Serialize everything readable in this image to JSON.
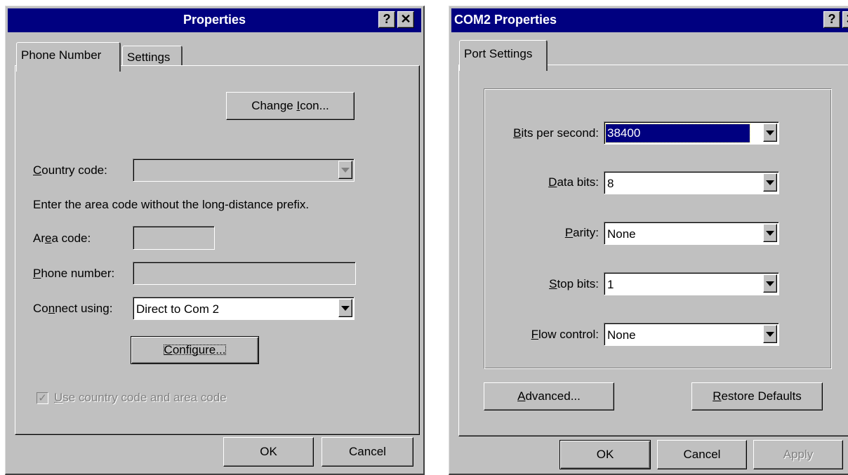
{
  "properties_dialog": {
    "title": "Properties",
    "help_glyph": "?",
    "close_glyph": "✕",
    "tabs": [
      "Phone Number",
      "Settings"
    ],
    "change_icon_button": {
      "pre": "Change ",
      "key": "I",
      "post": "con..."
    },
    "country_code": {
      "pre": "",
      "key": "C",
      "post": "ountry code:",
      "value": ""
    },
    "instruction_text": "Enter the area code without the long-distance prefix.",
    "area_code": {
      "pre": "Ar",
      "key": "e",
      "post": "a code:",
      "value": ""
    },
    "phone_number": {
      "pre": "",
      "key": "P",
      "post": "hone number:",
      "value": ""
    },
    "connect_using": {
      "pre": "Co",
      "key": "n",
      "post": "nect using:",
      "value": "Direct to Com 2"
    },
    "configure_button": {
      "pre": "",
      "key": "C",
      "post": "onfigure..."
    },
    "use_country_code": {
      "pre": "",
      "key": "U",
      "post": "se country code and area code",
      "checked": true
    },
    "ok_button": "OK",
    "cancel_button": "Cancel"
  },
  "com2_dialog": {
    "title": "COM2 Properties",
    "help_glyph": "?",
    "close_glyph": "✕",
    "tab": "Port Settings",
    "fields": {
      "bits_per_second": {
        "pre": "",
        "key": "B",
        "post": "its per second:",
        "value": "38400"
      },
      "data_bits": {
        "pre": "",
        "key": "D",
        "post": "ata bits:",
        "value": "8"
      },
      "parity": {
        "pre": "",
        "key": "P",
        "post": "arity:",
        "value": "None"
      },
      "stop_bits": {
        "pre": "",
        "key": "S",
        "post": "top bits:",
        "value": "1"
      },
      "flow_control": {
        "pre": "",
        "key": "F",
        "post": "low control:",
        "value": "None"
      }
    },
    "advanced_button": {
      "pre": "",
      "key": "A",
      "post": "dvanced..."
    },
    "restore_defaults_button": {
      "pre": "",
      "key": "R",
      "post": "estore Defaults"
    },
    "ok_button": "OK",
    "cancel_button": "Cancel",
    "apply_button": "Apply"
  }
}
